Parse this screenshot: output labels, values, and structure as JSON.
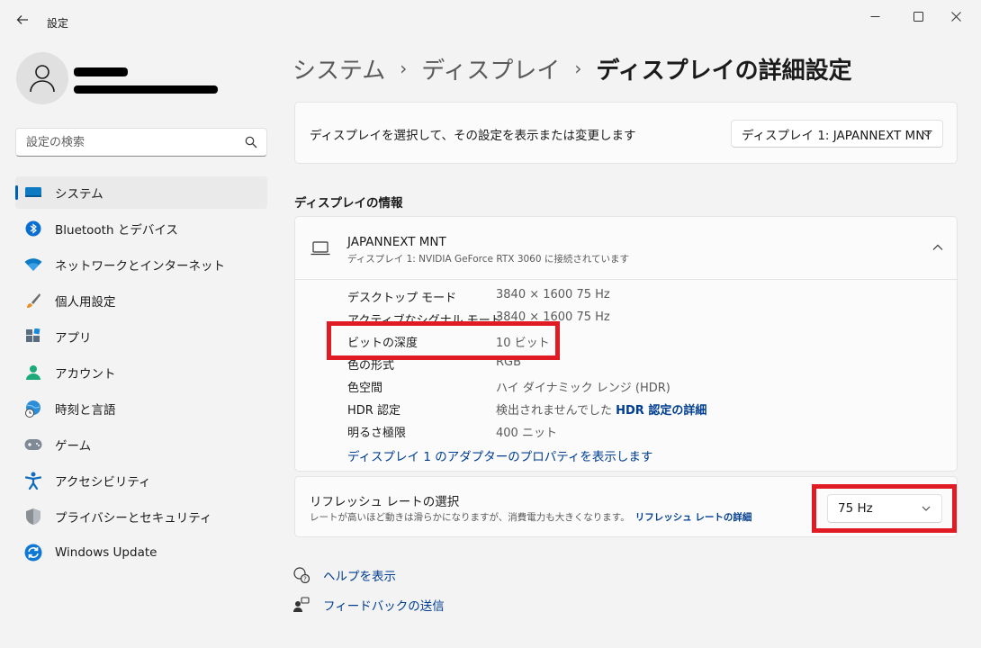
{
  "window": {
    "title": "設定",
    "back_icon": "back-arrow-icon",
    "controls": [
      "minimize-icon",
      "maximize-icon",
      "close-icon"
    ]
  },
  "user": {
    "avatar_icon": "person-icon"
  },
  "search": {
    "placeholder": "設定の検索",
    "icon": "search-icon"
  },
  "sidebar": {
    "items": [
      {
        "label": "システム",
        "icon": "system-display-icon",
        "active": true
      },
      {
        "label": "Bluetooth とデバイス",
        "icon": "bluetooth-icon",
        "active": false
      },
      {
        "label": "ネットワークとインターネット",
        "icon": "wifi-icon",
        "active": false
      },
      {
        "label": "個人用設定",
        "icon": "paintbrush-icon",
        "active": false
      },
      {
        "label": "アプリ",
        "icon": "apps-icon",
        "active": false
      },
      {
        "label": "アカウント",
        "icon": "account-icon",
        "active": false
      },
      {
        "label": "時刻と言語",
        "icon": "globe-clock-icon",
        "active": false
      },
      {
        "label": "ゲーム",
        "icon": "gamepad-icon",
        "active": false
      },
      {
        "label": "アクセシビリティ",
        "icon": "accessibility-icon",
        "active": false
      },
      {
        "label": "プライバシーとセキュリティ",
        "icon": "shield-icon",
        "active": false
      },
      {
        "label": "Windows Update",
        "icon": "windows-update-icon",
        "active": false
      }
    ]
  },
  "breadcrumb": {
    "items": [
      "システム",
      "ディスプレイ",
      "ディスプレイの詳細設定"
    ],
    "separator": "›"
  },
  "display_select": {
    "description": "ディスプレイを選択して、その設定を表示または変更します",
    "selected": "ディスプレイ 1: JAPANNEXT MNT"
  },
  "display_info": {
    "section_title": "ディスプレイの情報",
    "monitor_name": "JAPANNEXT MNT",
    "monitor_subtitle": "ディスプレイ 1: NVIDIA GeForce RTX 3060 に接続されています",
    "rows": [
      {
        "key": "デスクトップ モード",
        "value": "3840 × 1600 75 Hz"
      },
      {
        "key": "アクティブなシグナル モード",
        "value": "3840 × 1600 75 Hz"
      },
      {
        "key": "ビットの深度",
        "value": "10 ビット"
      },
      {
        "key": "色の形式",
        "value": "RGB"
      },
      {
        "key": "色空間",
        "value": "ハイ ダイナミック レンジ (HDR)"
      },
      {
        "key": "HDR 認定",
        "value": "検出されませんでした",
        "link": "HDR 認定の詳細"
      },
      {
        "key": "明るさ極限",
        "value": "400 ニット"
      }
    ],
    "adapter_link": "ディスプレイ 1 のアダプターのプロパティを表示します"
  },
  "refresh_rate": {
    "title": "リフレッシュ レートの選択",
    "description": "レートが高いほど動きは滑らかになりますが、消費電力も大きくなります。",
    "link": "リフレッシュ レートの詳細",
    "selected": "75 Hz"
  },
  "footer": {
    "help_label": "ヘルプを表示",
    "feedback_label": "フィードバックの送信"
  },
  "colors": {
    "accent": "#005fb8",
    "link": "#003e92",
    "highlight_box": "#e01b24",
    "background": "#f3f3f3",
    "card": "#fbfbfb"
  }
}
